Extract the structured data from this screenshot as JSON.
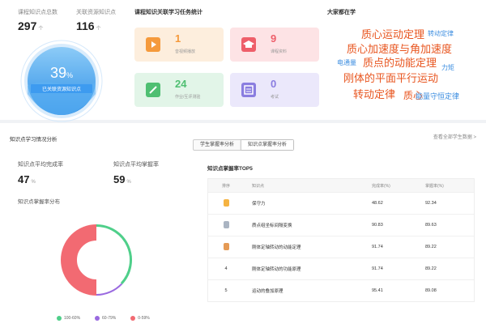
{
  "stats": {
    "total_label": "课程知识点总数",
    "total_value": "297",
    "total_unit": "个",
    "linked_label": "关联资源知识点",
    "linked_value": "116",
    "linked_unit": "个",
    "coverage_value": "39",
    "coverage_suffix": "%",
    "coverage_text": "已关联资源知识点",
    "coverage_fraction": 0.39
  },
  "tasks": {
    "title": "课程知识关联学习任务统计",
    "cards": [
      {
        "num": "1",
        "label": "音视频播放",
        "icon": "video-icon",
        "color": "#f59a3c"
      },
      {
        "num": "9",
        "label": "课程资料",
        "icon": "graduation-cap-icon",
        "color": "#ee5f6a"
      },
      {
        "num": "24",
        "label": "作业/互评测验",
        "icon": "edit-icon",
        "color": "#4fbf72"
      },
      {
        "num": "0",
        "label": "考试",
        "icon": "exam-icon",
        "color": "#8a7de0"
      }
    ]
  },
  "wordcloud": {
    "title": "大家都在学",
    "words": [
      {
        "text": "质心运动定理",
        "color": "#e8551f"
      },
      {
        "text": "转动定律",
        "color": "#3d8ee0"
      },
      {
        "text": "质心加速度与角加速度",
        "color": "#e8551f"
      },
      {
        "text": "电通量",
        "color": "#3d8ee0"
      },
      {
        "text": "质点的动能定理",
        "color": "#e8551f"
      },
      {
        "text": "力矩",
        "color": "#3d8ee0"
      },
      {
        "text": "刚体的平面平行运动",
        "color": "#e8551f"
      },
      {
        "text": "转动定律",
        "color": "#e8551f"
      },
      {
        "text": "质心",
        "color": "#e8551f"
      },
      {
        "text": "能量守恒定律",
        "color": "#3d8ee0"
      }
    ]
  },
  "analysis": {
    "title": "知识点学习情况分析",
    "tabs": [
      "学生掌握率分析",
      "知识点掌握率分析"
    ],
    "active_tab": 1,
    "view_all": "查看全部学生数据 >",
    "avg_completion_label": "知识点平均完成率",
    "avg_completion_value": "47",
    "avg_mastery_label": "知识点平均掌握率",
    "avg_mastery_value": "59",
    "pct_unit": "%",
    "distribution_title": "知识点掌握率分布",
    "distribution": [
      {
        "label": "100-60%",
        "color": "#4fcf8a",
        "value": 37
      },
      {
        "label": "60-79%",
        "color": "#9a6ae0",
        "value": 13
      },
      {
        "label": "0-59%",
        "color": "#f26a72",
        "value": 50
      }
    ]
  },
  "top5": {
    "title": "知识点掌握率TOP5",
    "headers": [
      "排序",
      "知识点",
      "完成率(%)",
      "掌握率(%)"
    ],
    "rows": [
      {
        "rank": "",
        "medal": "#f5b342",
        "name": "保守力",
        "rate": "48.62",
        "mastery": "92.34"
      },
      {
        "rank": "",
        "medal": "#aab4c2",
        "name": "质点组坐标间隔变换",
        "rate": "90.83",
        "mastery": "89.63"
      },
      {
        "rank": "",
        "medal": "#e59a55",
        "name": "刚体定轴转动的动能定理",
        "rate": "91.74",
        "mastery": "89.22"
      },
      {
        "rank": "4",
        "medal": "",
        "name": "刚体定轴转动的功能原理",
        "rate": "91.74",
        "mastery": "89.22"
      },
      {
        "rank": "5",
        "medal": "",
        "name": "运动的叠加原理",
        "rate": "95.41",
        "mastery": "89.08"
      }
    ]
  }
}
